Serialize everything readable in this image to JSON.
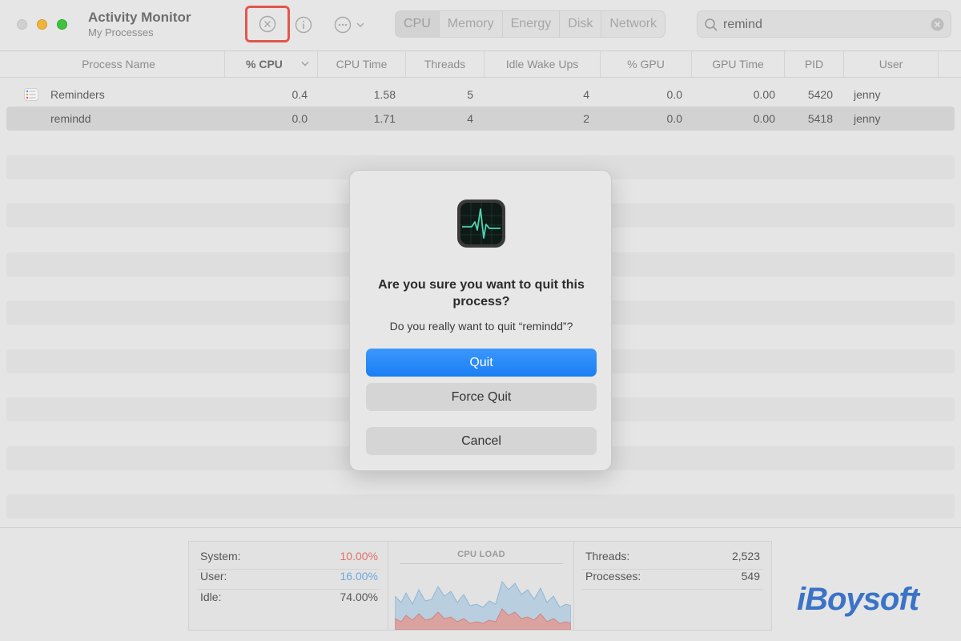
{
  "window": {
    "title": "Activity Monitor",
    "subtitle": "My Processes"
  },
  "toolbar": {
    "tabs": [
      "CPU",
      "Memory",
      "Energy",
      "Disk",
      "Network"
    ],
    "active_tab": "CPU",
    "search_value": "remind"
  },
  "columns": [
    "Process Name",
    "% CPU",
    "CPU Time",
    "Threads",
    "Idle Wake Ups",
    "% GPU",
    "GPU Time",
    "PID",
    "User"
  ],
  "rows": [
    {
      "name": "Reminders",
      "cpu": "0.4",
      "cpu_time": "1.58",
      "threads": "5",
      "idle": "4",
      "gpu": "0.0",
      "gpu_time": "0.00",
      "pid": "5420",
      "user": "jenny"
    },
    {
      "name": "remindd",
      "cpu": "0.0",
      "cpu_time": "1.71",
      "threads": "4",
      "idle": "2",
      "gpu": "0.0",
      "gpu_time": "0.00",
      "pid": "5418",
      "user": "jenny"
    }
  ],
  "dialog": {
    "title": "Are you sure you want to quit this process?",
    "message": "Do you really want to quit “remindd”?",
    "quit_label": "Quit",
    "force_quit_label": "Force Quit",
    "cancel_label": "Cancel"
  },
  "stats": {
    "system_label": "System:",
    "system_value": "10.00%",
    "user_label": "User:",
    "user_value": "16.00%",
    "idle_label": "Idle:",
    "idle_value": "74.00%",
    "cpu_load_title": "CPU LOAD",
    "threads_label": "Threads:",
    "threads_value": "2,523",
    "processes_label": "Processes:",
    "processes_value": "549"
  },
  "colors": {
    "system": "#e0706a",
    "user": "#6aa8dd",
    "accent": "#1a7ef4",
    "highlight": "#e2574c"
  },
  "watermark": "iBoysoft"
}
